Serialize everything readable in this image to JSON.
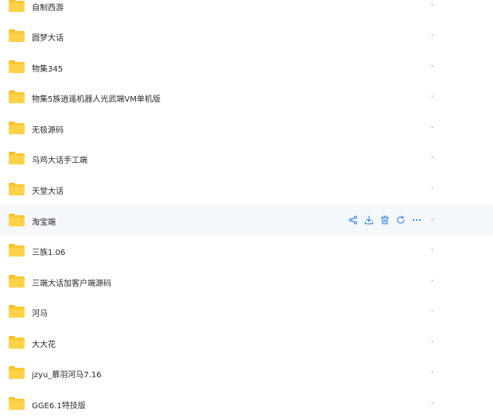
{
  "files": [
    {
      "name": "自制西游",
      "size": "-"
    },
    {
      "name": "圆梦大话",
      "size": "-"
    },
    {
      "name": "物集345",
      "size": "-"
    },
    {
      "name": "物集5族逍遥机器人光武端VM单机版",
      "size": "-"
    },
    {
      "name": "无极源码",
      "size": "-"
    },
    {
      "name": "乌鸡大话手工端",
      "size": "-"
    },
    {
      "name": "天堂大话",
      "size": "-"
    },
    {
      "name": "淘宝端",
      "size": "-",
      "hovered": true
    },
    {
      "name": "三族1.06",
      "size": "-"
    },
    {
      "name": "三端大话加客户端源码",
      "size": "-"
    },
    {
      "name": "河马",
      "size": "-"
    },
    {
      "name": "大大花",
      "size": "-"
    },
    {
      "name": "jzyu_慕羽河马7.16",
      "size": "-"
    },
    {
      "name": "GGE6.1特技版",
      "size": "-"
    }
  ],
  "row_actions": [
    {
      "icon": "share-icon",
      "label": "分享"
    },
    {
      "icon": "download-icon",
      "label": "下载"
    },
    {
      "icon": "delete-icon",
      "label": "删除"
    },
    {
      "icon": "refresh-icon",
      "label": "刷新"
    },
    {
      "icon": "more-icon",
      "label": "更多"
    }
  ],
  "colors": {
    "folder": "#fdc830",
    "accent": "#3a86ea",
    "hover_bg": "#f5f8fd"
  }
}
